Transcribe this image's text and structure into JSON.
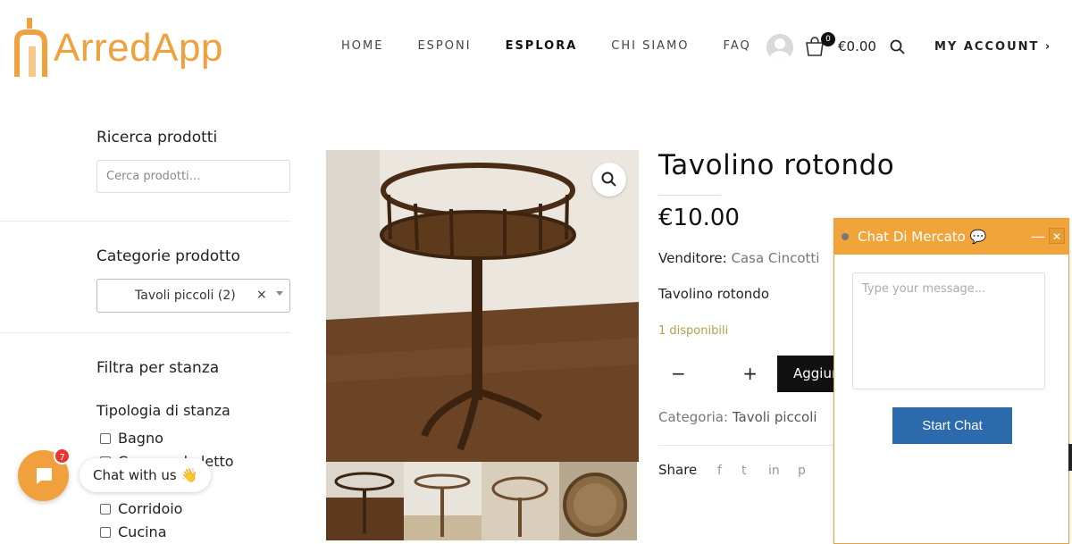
{
  "brand": {
    "name": "ArredApp",
    "color": "#f0a03c"
  },
  "nav": {
    "items": [
      {
        "label": "HOME"
      },
      {
        "label": "ESPONI"
      },
      {
        "label": "ESPLORA"
      },
      {
        "label": "CHI SIAMO"
      },
      {
        "label": "FAQ"
      }
    ],
    "active": "ESPLORA"
  },
  "header": {
    "cart_count": "0",
    "cart_total": "€0.00",
    "account_label": "MY ACCOUNT ›"
  },
  "sidebar": {
    "search_title": "Ricerca prodotti",
    "search_placeholder": "Cerca prodotti…",
    "category_title": "Categorie prodotto",
    "category_selected": "Tavoli piccoli  (2)",
    "category_clear": "×",
    "room_title": "Filtra per stanza",
    "room_subtitle": "Tipologia di stanza",
    "rooms": [
      "Bagno",
      "Camera da letto",
      "Corridoio",
      "Cucina"
    ]
  },
  "product": {
    "title": "Tavolino rotondo",
    "price": "€10.00",
    "vendor_label": "Venditore:",
    "vendor_name": "Casa Cincotti",
    "short_description": "Tavolino rotondo",
    "stock": "1 disponibili",
    "qty_minus": "−",
    "qty_plus": "+",
    "add_to_cart": "Aggiungi al carrello",
    "category_label": "Categoria:",
    "category_name": "Tavoli piccoli",
    "share_label": "Share",
    "social": [
      "f",
      "t",
      "in",
      "p"
    ]
  },
  "chat": {
    "title": "Chat Di Mercato 💬",
    "minimize": "—",
    "close": "✕",
    "placeholder": "Type your message...",
    "start_button": "Start Chat",
    "launcher_badge": "7",
    "bubble_text": "Chat with us 👋"
  }
}
